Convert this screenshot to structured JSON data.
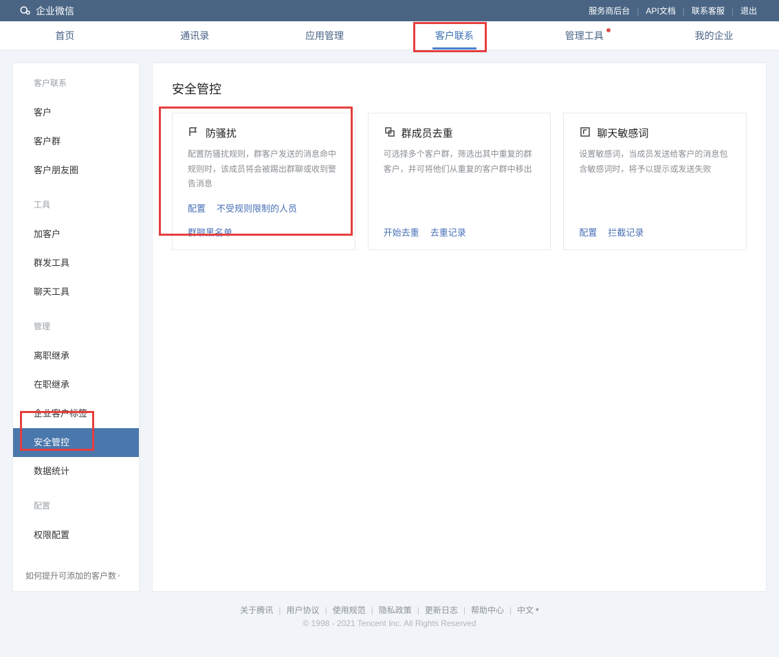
{
  "brand": "企业微信",
  "top_links": {
    "provider": "服务商后台",
    "api": "API文档",
    "contact": "联系客服",
    "logout": "退出"
  },
  "nav": {
    "items": [
      {
        "label": "首页"
      },
      {
        "label": "通讯录"
      },
      {
        "label": "应用管理"
      },
      {
        "label": "客户联系",
        "active": true
      },
      {
        "label": "管理工具",
        "dot": true
      },
      {
        "label": "我的企业"
      }
    ]
  },
  "sidebar": {
    "groups": [
      {
        "title": "客户联系",
        "items": [
          {
            "label": "客户"
          },
          {
            "label": "客户群"
          },
          {
            "label": "客户朋友圈"
          }
        ]
      },
      {
        "title": "工具",
        "items": [
          {
            "label": "加客户"
          },
          {
            "label": "群发工具"
          },
          {
            "label": "聊天工具"
          }
        ]
      },
      {
        "title": "管理",
        "items": [
          {
            "label": "离职继承"
          },
          {
            "label": "在职继承"
          },
          {
            "label": "企业客户标签"
          },
          {
            "label": "安全管控",
            "active": true
          },
          {
            "label": "数据统计"
          }
        ]
      },
      {
        "title": "配置",
        "items": [
          {
            "label": "权限配置"
          }
        ]
      }
    ],
    "bottom": "如何提升可添加的客户数"
  },
  "main": {
    "title": "安全管控",
    "cards": [
      {
        "icon": "flag",
        "title": "防骚扰",
        "desc": "配置防骚扰规则，群客户发送的消息命中规则时，该成员将会被踢出群聊或收到警告消息",
        "actions": [
          {
            "label": "配置"
          },
          {
            "label": "不受规则限制的人员"
          },
          {
            "label": "群聊黑名单"
          }
        ]
      },
      {
        "icon": "dedupe",
        "title": "群成员去重",
        "desc": "可选择多个客户群，筛选出其中重复的群客户，并可将他们从重复的客户群中移出",
        "actions": [
          {
            "label": "开始去重"
          },
          {
            "label": "去重记录"
          }
        ]
      },
      {
        "icon": "sensitive",
        "title": "聊天敏感词",
        "desc": "设置敏感词，当成员发送给客户的消息包含敏感词时，将予以提示或发送失败",
        "actions": [
          {
            "label": "配置"
          },
          {
            "label": "拦截记录"
          }
        ]
      }
    ]
  },
  "footer": {
    "links": [
      {
        "label": "关于腾讯"
      },
      {
        "label": "用户协议"
      },
      {
        "label": "使用规范"
      },
      {
        "label": "隐私政策"
      },
      {
        "label": "更新日志"
      },
      {
        "label": "帮助中心"
      }
    ],
    "lang": "中文",
    "copyright": "© 1998 - 2021 Tencent Inc. All Rights Reserved"
  },
  "highlight_colors": {
    "box": "#e53e3e"
  }
}
